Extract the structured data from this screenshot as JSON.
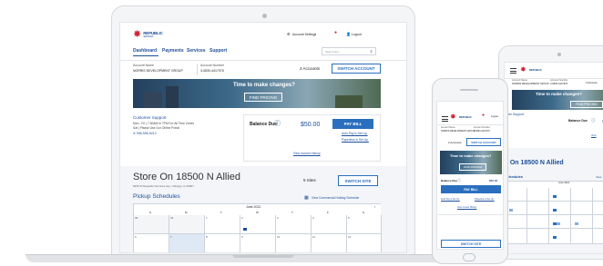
{
  "brand": {
    "name": "REPUBLIC",
    "sub": "SERVICES"
  },
  "header": {
    "account_settings": "Account Settings",
    "notification_count": "1",
    "logout": "Logout"
  },
  "nav": {
    "items": [
      "Dashboard",
      "Payments",
      "Services",
      "Support"
    ],
    "search_placeholder": "Search Ent..."
  },
  "account": {
    "name_label": "Account Name",
    "name": "NORRIS DEVELOPMENT GROUP",
    "number_label": "Account Number",
    "number": "3-0830-4417976",
    "count": "2 Accounts",
    "switch": "SWITCH ACCOUNT"
  },
  "banner": {
    "title": "Time to make changes?",
    "cta": "FIND PRICING"
  },
  "support": {
    "title": "Customer Support",
    "hours1": "Mon - Fri | 7:30AM to 7PM For All Time Zones",
    "hours2": "Sat | Please Use Our Online Portal",
    "phone": "555-555-5212"
  },
  "balance": {
    "label": "Balance Due",
    "amount": "$50.00",
    "amount_phone": "$50.00",
    "pay": "PAY BILL",
    "autopay": "Auto Pay is Set Up.",
    "paperless": "Paperless is Set Up.",
    "invoice": "View Invoice History"
  },
  "site": {
    "title": "Store On 18500 N Allied",
    "title_tablet": "e On 18500 N Allied",
    "address": "8236 W Republic Services Ave, Chicago, IL 60607",
    "sites": "5 Sites",
    "switch": "SWITCH SITE"
  },
  "schedule": {
    "title": "Pickup Schedules",
    "commercial": "View Commercial Holiday Schedule",
    "month": "June 2021",
    "days": [
      "S",
      "M",
      "T",
      "W",
      "T",
      "F",
      "S"
    ],
    "dates": [
      "30",
      "31",
      "1",
      "2",
      "3",
      "4",
      "5",
      "6",
      "7",
      "8",
      "9",
      "10",
      "11",
      "12"
    ]
  },
  "phone": {
    "balance_label": "Balance Due",
    "autopay": "Auto Pay is Set Up.",
    "paperless": "Paperless is Set Up.",
    "invoice": "View invoice History",
    "switch": "SWITCH SITE",
    "count": "2 Accounts",
    "switch_account": "SWITCH ACCOUNT"
  },
  "tablet": {
    "find": "FIND PRICING",
    "support": "omer Support",
    "schedules": "Schedules",
    "view": "View"
  },
  "colors": {
    "brand_blue": "#1d4f9b",
    "action_blue": "#2a6fbf",
    "brand_red": "#d3263a"
  }
}
